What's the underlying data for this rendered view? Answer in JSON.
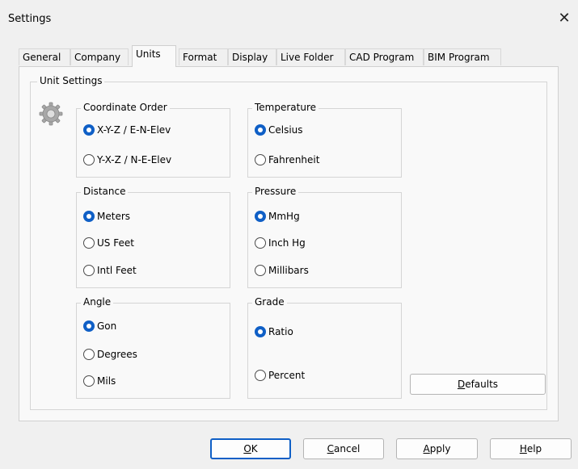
{
  "window": {
    "title": "Settings",
    "close_glyph": "✕"
  },
  "tabs": [
    {
      "label": "General"
    },
    {
      "label": "Company"
    },
    {
      "label": "Units"
    },
    {
      "label": "Format"
    },
    {
      "label": "Display"
    },
    {
      "label": "Live Folder"
    },
    {
      "label": "CAD Program"
    },
    {
      "label": "BIM Program"
    }
  ],
  "active_tab": "Units",
  "unit_settings": {
    "label": "Unit Settings",
    "icon": "gear-icon",
    "coordinate_order": {
      "label": "Coordinate Order",
      "options": [
        "X-Y-Z / E-N-Elev",
        "Y-X-Z / N-E-Elev"
      ],
      "selected": "X-Y-Z / E-N-Elev"
    },
    "distance": {
      "label": "Distance",
      "options": [
        "Meters",
        "US Feet",
        "Intl Feet"
      ],
      "selected": "Meters"
    },
    "angle": {
      "label": "Angle",
      "options": [
        "Gon",
        "Degrees",
        "Mils"
      ],
      "selected": "Gon"
    },
    "temperature": {
      "label": "Temperature",
      "options": [
        "Celsius",
        "Fahrenheit"
      ],
      "selected": "Celsius"
    },
    "pressure": {
      "label": "Pressure",
      "options": [
        "MmHg",
        "Inch Hg",
        "Millibars"
      ],
      "selected": "MmHg"
    },
    "grade": {
      "label": "Grade",
      "options": [
        "Ratio",
        "Percent"
      ],
      "selected": "Ratio"
    }
  },
  "defaults_button": {
    "mnemonic": "D",
    "rest": "efaults"
  },
  "footer": {
    "ok": {
      "mnemonic": "O",
      "rest": "K"
    },
    "cancel": {
      "mnemonic": "C",
      "rest": "ancel"
    },
    "apply": {
      "mnemonic": "A",
      "rest": "pply"
    },
    "help": {
      "mnemonic": "H",
      "rest": "elp"
    }
  },
  "colors": {
    "accent": "#0f5fc6",
    "window_bg": "#f0f0f0",
    "panel_bg": "#f9f9f9"
  }
}
